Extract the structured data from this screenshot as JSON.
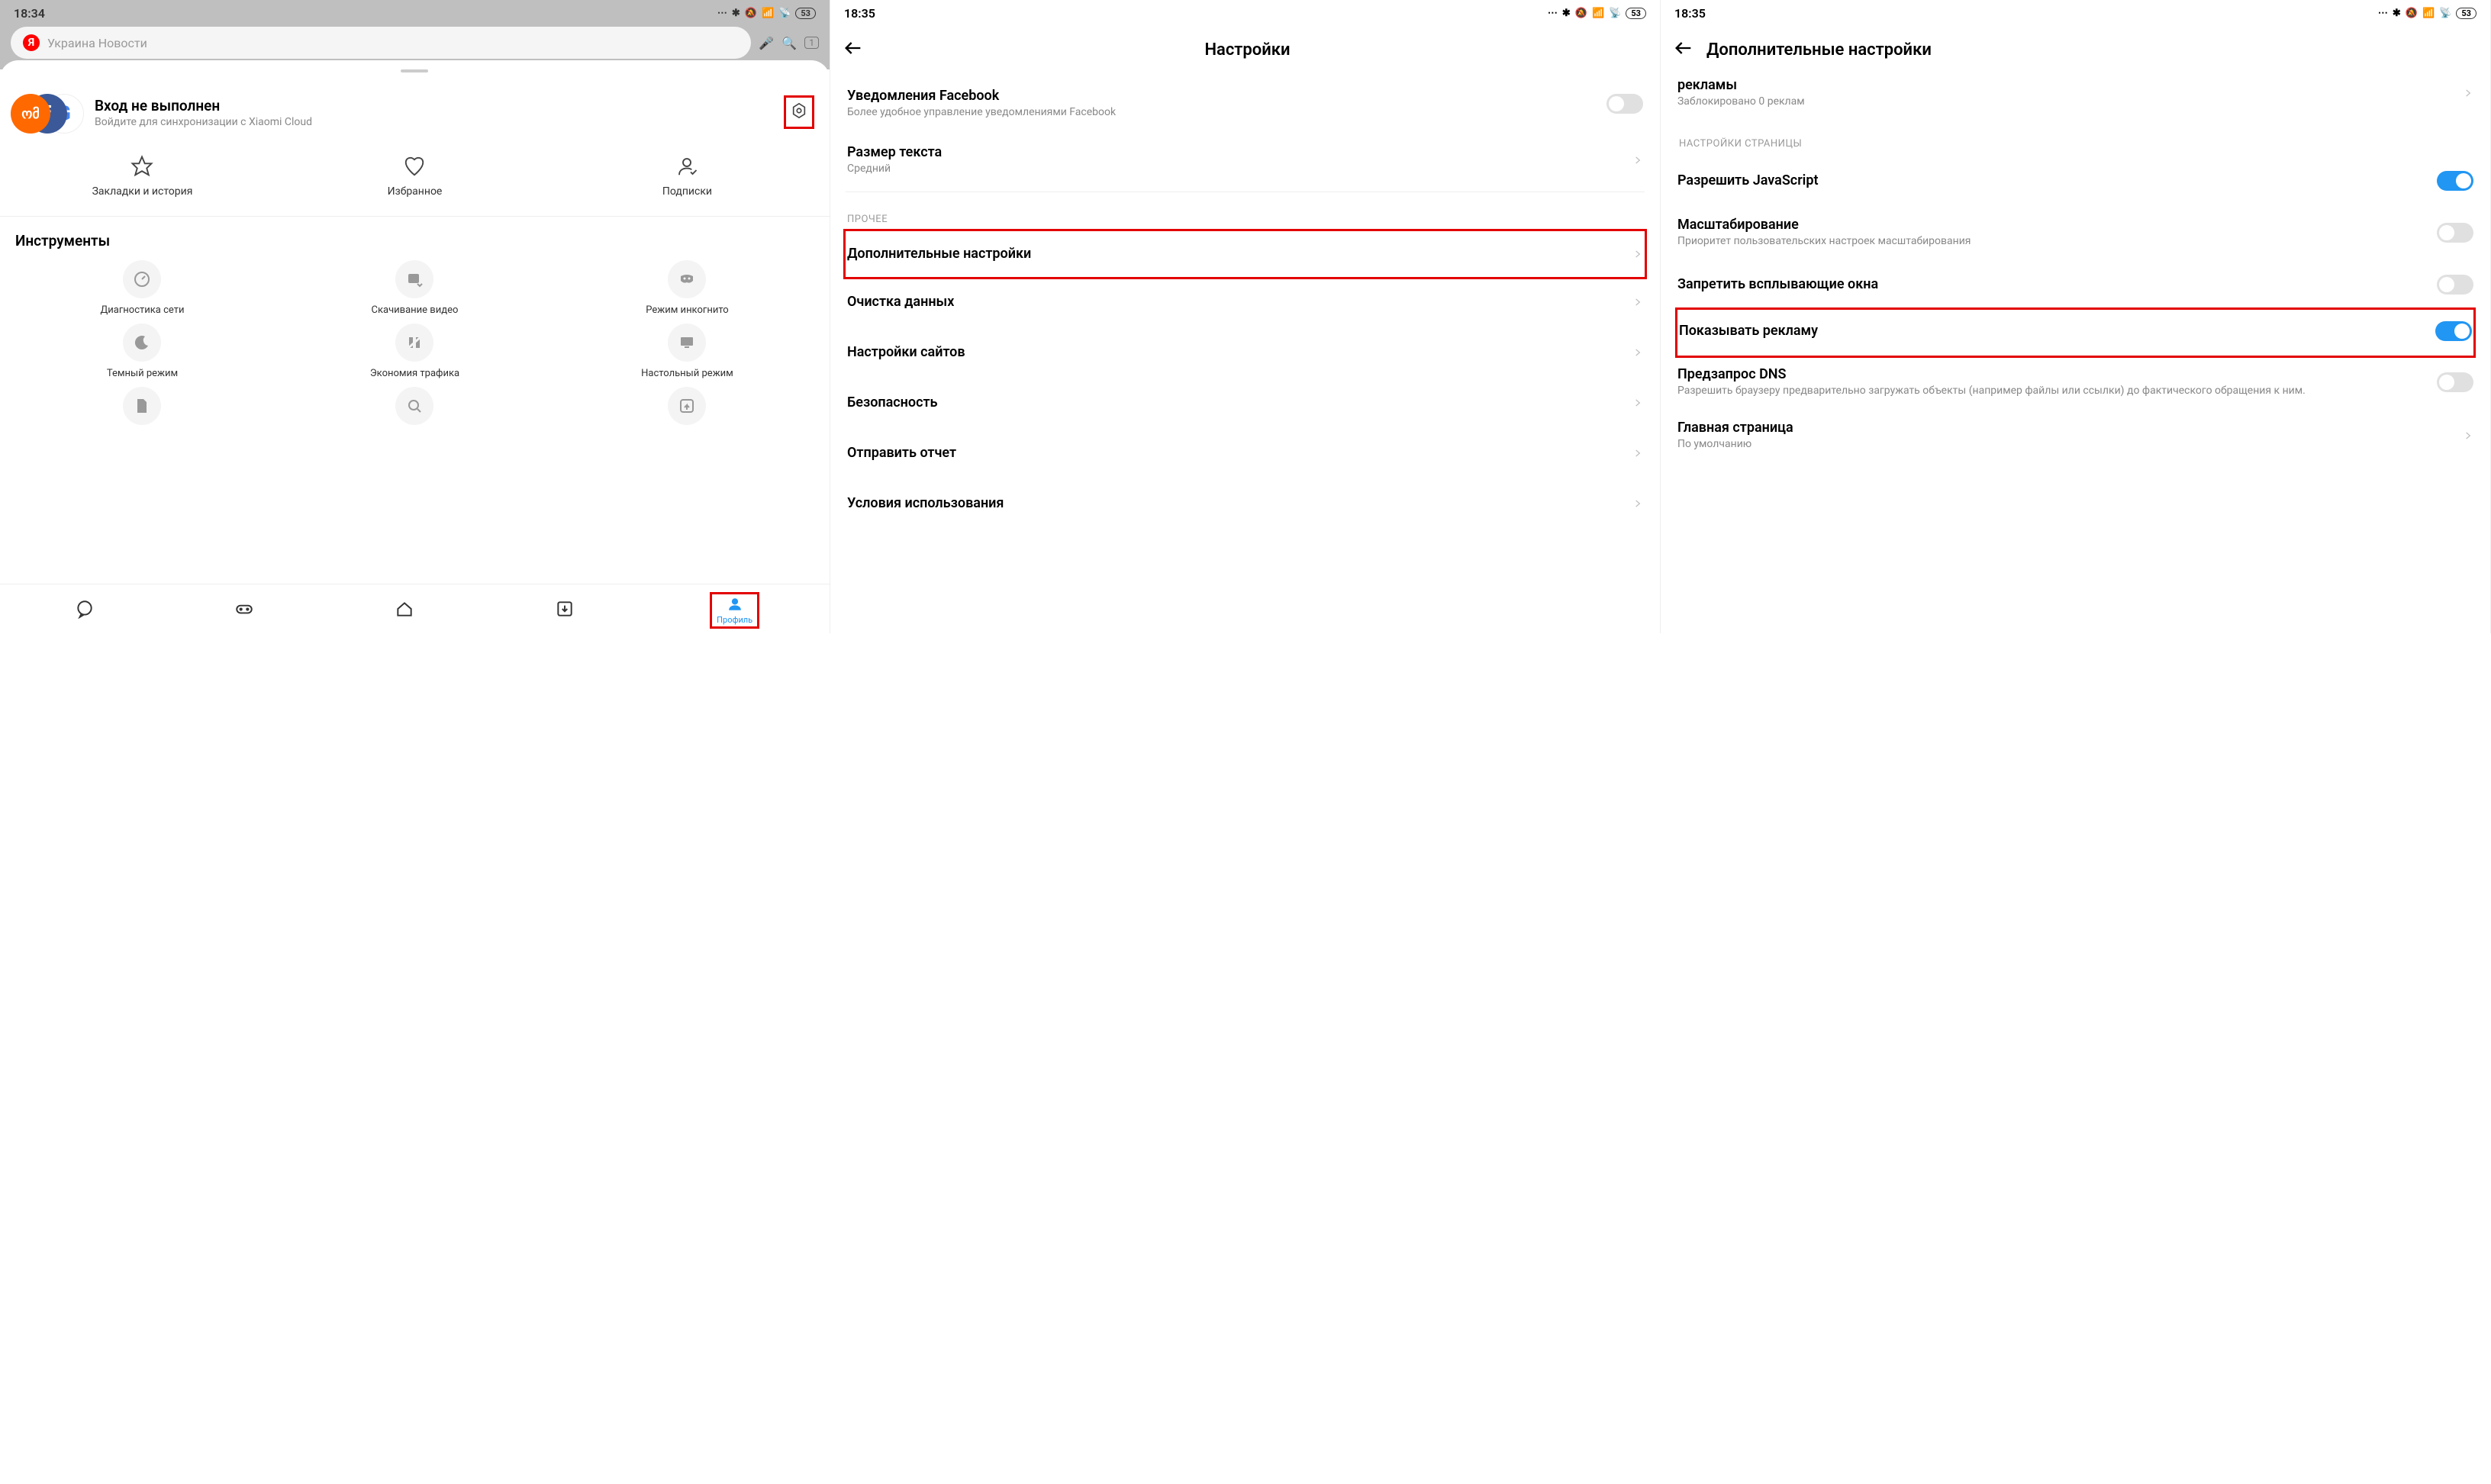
{
  "status": {
    "time1": "18:34",
    "time2": "18:35",
    "time3": "18:35",
    "battery": "53"
  },
  "s1": {
    "search_placeholder": "Украина Новости",
    "login_title": "Вход не выполнен",
    "login_sub": "Войдите для синхронизации с Xiaomi Cloud",
    "quick": [
      {
        "label": "Закладки и история"
      },
      {
        "label": "Избранное"
      },
      {
        "label": "Подписки"
      }
    ],
    "tools_header": "Инструменты",
    "tools": [
      {
        "label": "Диагностика сети"
      },
      {
        "label": "Скачивание видео"
      },
      {
        "label": "Режим инкогнито"
      },
      {
        "label": "Темный режим"
      },
      {
        "label": "Экономия трафика"
      },
      {
        "label": "Настольный режим"
      }
    ],
    "profile_label": "Профиль"
  },
  "s2": {
    "title": "Настройки",
    "fb_title": "Уведомления Facebook",
    "fb_sub": "Более удобное управление уведомлениями Facebook",
    "text_size_title": "Размер текста",
    "text_size_value": "Средний",
    "section_other": "ПРОЧЕЕ",
    "items": [
      {
        "label": "Дополнительные настройки",
        "highlight": true
      },
      {
        "label": "Очистка данных"
      },
      {
        "label": "Настройки сайтов"
      },
      {
        "label": "Безопасность"
      },
      {
        "label": "Отправить отчет"
      },
      {
        "label": "Условия использования"
      }
    ]
  },
  "s3": {
    "title": "Дополнительные настройки",
    "trunc_title": "рекламы",
    "trunc_sub": "Заблокировано 0 реклам",
    "section_page": "НАСТРОЙКИ СТРАНИЦЫ",
    "rows": [
      {
        "title": "Разрешить JavaScript",
        "toggle": true,
        "on": true
      },
      {
        "title": "Масштабирование",
        "sub": "Приоритет пользовательских настроек масштабирования",
        "toggle": true,
        "on": false
      },
      {
        "title": "Запретить всплывающие окна",
        "toggle": true,
        "on": false
      },
      {
        "title": "Показывать рекламу",
        "toggle": true,
        "on": true,
        "highlight": true
      },
      {
        "title": "Предзапрос DNS",
        "sub": "Разрешить браузеру предварительно загружать объекты (например файлы или ссылки) до фактического обращения к ним.",
        "toggle": true,
        "on": false
      },
      {
        "title": "Главная страница",
        "sub": "По умолчанию",
        "chevron": true
      }
    ]
  }
}
